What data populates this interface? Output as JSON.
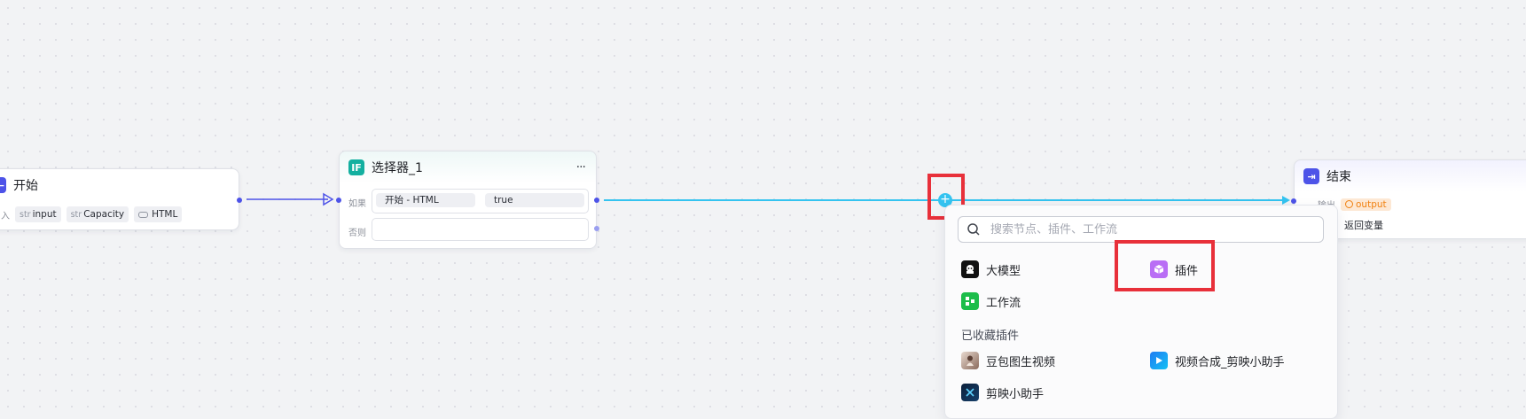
{
  "start_node": {
    "title": "开始",
    "input_label": "入",
    "params": [
      {
        "type": "str",
        "name": "input"
      },
      {
        "type": "str",
        "name": "Capacity"
      },
      {
        "type": "",
        "name": "HTML"
      }
    ]
  },
  "selector_node": {
    "title": "选择器_1",
    "more": "···",
    "if_label": "如果",
    "else_label": "否则",
    "condition_left": "开始 - HTML",
    "condition_right": "true"
  },
  "end_node": {
    "title": "结束",
    "output_label": "输出",
    "output_tag": "output",
    "return_label": "返回变量"
  },
  "add_panel": {
    "search_placeholder": "搜索节点、插件、工作流",
    "items": [
      {
        "label": "大模型",
        "icon": "llm-icon"
      },
      {
        "label": "插件",
        "icon": "plugin-icon"
      },
      {
        "label": "工作流",
        "icon": "workflow-icon"
      }
    ],
    "favorites_label": "已收藏插件",
    "favorites": [
      {
        "label": "豆包图生视频",
        "icon": "doubao-icon"
      },
      {
        "label": "视频合成_剪映小助手",
        "icon": "video-compose-icon"
      },
      {
        "label": "剪映小助手",
        "icon": "jianying-icon"
      }
    ]
  },
  "colors": {
    "accent": "#4d53e8",
    "active_edge": "#34c3f0",
    "highlight": "#e8303a",
    "selector_icon": "#13b0a0",
    "output_tag_bg": "#fde8d4",
    "output_tag_text": "#f08010"
  }
}
